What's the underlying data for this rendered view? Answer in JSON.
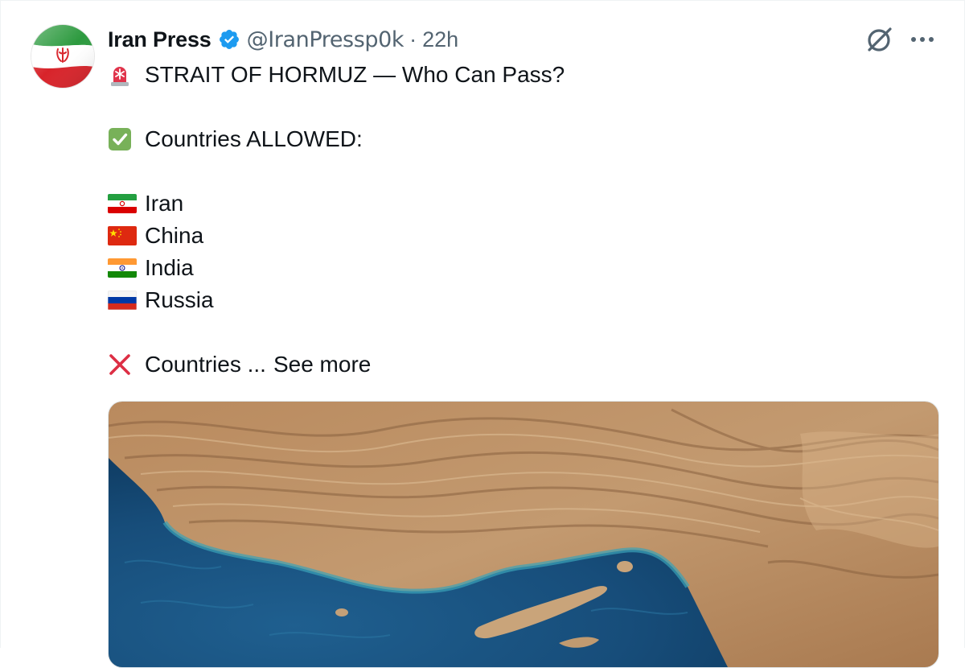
{
  "tweet": {
    "author_name": "Iran Press",
    "handle": "@IranPressp0k",
    "separator": "·",
    "time": "22h",
    "lines": {
      "headline": "STRAIT OF HORMUZ — Who Can Pass?",
      "allowed_heading": "Countries ALLOWED:",
      "countries": [
        "Iran",
        "China",
        "India",
        "Russia"
      ],
      "blocked_heading": "Countries ...",
      "see_more": "See more"
    },
    "icons": {
      "headline_emoji": "rotating-light-icon",
      "allowed_emoji": "check-mark-button-icon",
      "blocked_emoji": "cross-mark-icon",
      "flags": [
        "iran-flag-icon",
        "china-flag-icon",
        "india-flag-icon",
        "russia-flag-icon"
      ],
      "verified": "verified-badge-icon",
      "grok": "grok-icon",
      "more": "more-options-icon"
    },
    "colors": {
      "verified_blue": "#1d9bf0",
      "secondary_text": "#536471",
      "primary_text": "#0f1419"
    }
  }
}
